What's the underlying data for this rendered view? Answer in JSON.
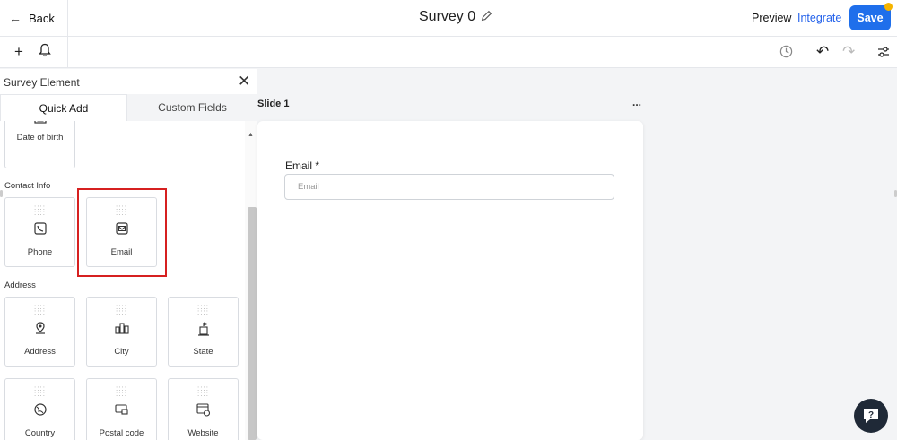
{
  "header": {
    "back_label": "Back",
    "survey_title": "Survey 0",
    "preview_label": "Preview",
    "integrate_label": "Integrate",
    "save_label": "Save",
    "accent_color": "#1f6feb",
    "notification_dot_color": "#f5b400"
  },
  "toolbar": {
    "icons": [
      "plus-icon",
      "bell-icon",
      "history-icon",
      "undo-icon",
      "redo-icon",
      "settings-sliders-icon"
    ]
  },
  "panel": {
    "title": "Survey Element",
    "tabs": [
      {
        "label": "Quick Add",
        "active": true
      },
      {
        "label": "Custom Fields",
        "active": false
      }
    ],
    "sections": [
      {
        "label": "",
        "items": [
          {
            "label": "Date of birth",
            "icon": "calendar-icon"
          }
        ]
      },
      {
        "label": "Contact Info",
        "items": [
          {
            "label": "Phone",
            "icon": "phone-icon"
          },
          {
            "label": "Email",
            "icon": "email-icon",
            "highlighted": true
          }
        ]
      },
      {
        "label": "Address",
        "items": [
          {
            "label": "Address",
            "icon": "location-pin-icon"
          },
          {
            "label": "City",
            "icon": "city-icon"
          },
          {
            "label": "State",
            "icon": "state-building-icon"
          },
          {
            "label": "Country",
            "icon": "globe-icon"
          },
          {
            "label": "Postal code",
            "icon": "postal-icon"
          },
          {
            "label": "Website",
            "icon": "website-icon"
          }
        ]
      }
    ],
    "highlight_color": "#d62020"
  },
  "canvas": {
    "slide_label": "Slide 1",
    "slide_menu": "...",
    "field": {
      "label": "Email *",
      "placeholder": "Email"
    }
  }
}
